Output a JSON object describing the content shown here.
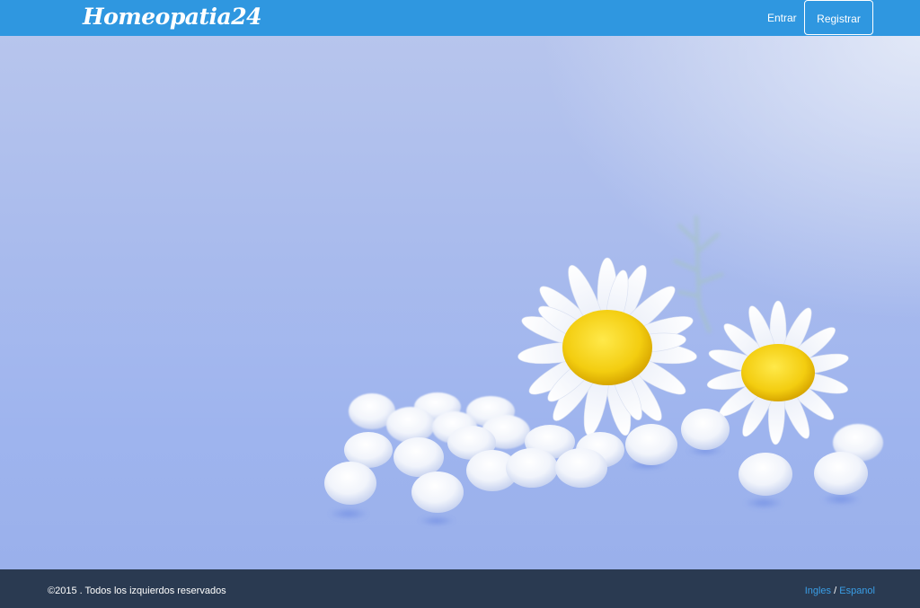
{
  "header": {
    "brand": "Homeopatia24",
    "login_label": "Entrar",
    "register_label": "Registrar",
    "background_color": "#2f97e0"
  },
  "hero": {
    "image": "white-daisy-flowers-with-homeopathic-globules-on-blue-background"
  },
  "footer": {
    "copyright": "©2015 . Todos los izquierdos reservados",
    "languages": [
      "Ingles",
      "Espanol"
    ],
    "separator": "/",
    "background_color": "#2a3a51",
    "link_color": "#3a9ee6"
  }
}
